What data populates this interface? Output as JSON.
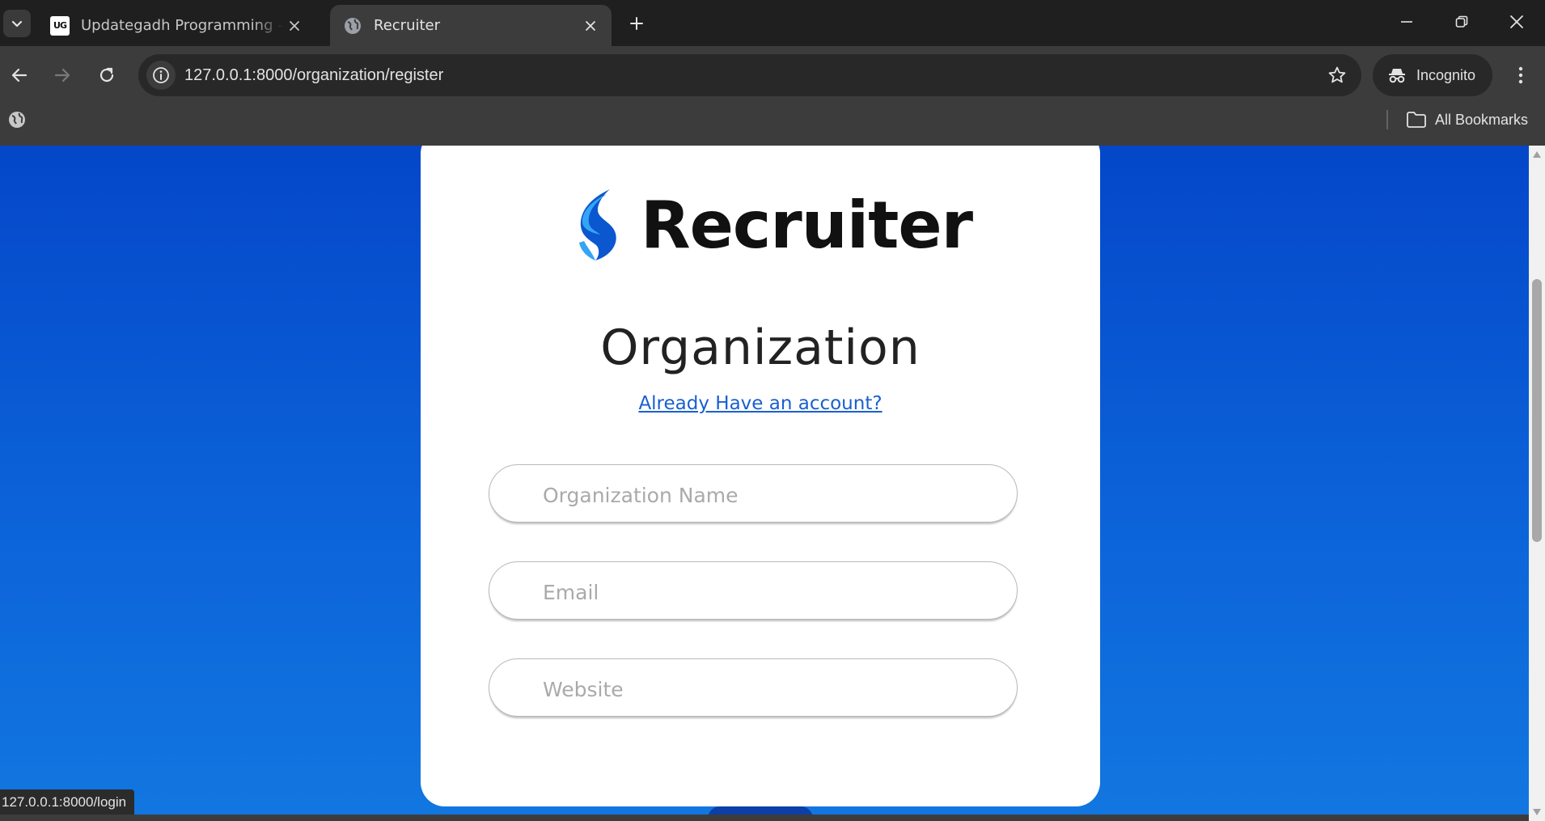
{
  "browser": {
    "tabs": [
      {
        "title": "Updategadh Programming - Updategadh",
        "favicon": "ug-logo",
        "active": false
      },
      {
        "title": "Recruiter",
        "favicon": "globe-icon",
        "active": true
      }
    ],
    "address_bar": {
      "url": "127.0.0.1:8000/organization/register"
    },
    "profile": {
      "label": "Incognito"
    },
    "bookmarks_bar": {
      "all_bookmarks_label": "All Bookmarks"
    },
    "status_bar": {
      "hover_url": "127.0.0.1:8000/login"
    }
  },
  "page": {
    "brand": {
      "name": "Recruiter",
      "logo": "recruiter-s-logo"
    },
    "heading": "Organization",
    "login_link": "Already Have an account?",
    "form": {
      "fields": [
        {
          "name": "organization_name",
          "placeholder": "Organization Name",
          "value": ""
        },
        {
          "name": "email",
          "placeholder": "Email",
          "value": ""
        },
        {
          "name": "website",
          "placeholder": "Website",
          "value": ""
        }
      ]
    }
  },
  "colors": {
    "page_background_top": "#0447c9",
    "page_background_bottom": "#1277e0",
    "card": "#ffffff",
    "link": "#1a5fd0",
    "logo_blue_dark": "#0b57d0",
    "logo_blue_light": "#35a4f4"
  }
}
